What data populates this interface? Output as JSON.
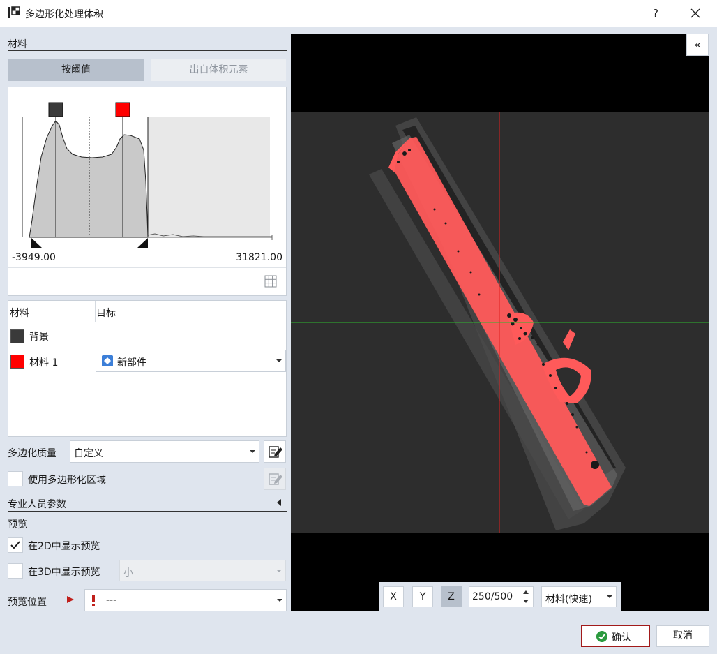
{
  "window": {
    "title": "多边形化处理体积",
    "help_label": "?"
  },
  "materials_section": {
    "title": "材料"
  },
  "mode_tabs": {
    "threshold": "按阈值",
    "from_volume": "出自体积元素"
  },
  "histogram": {
    "min_label": "-3949.00",
    "max_label": "31821.00"
  },
  "material_table": {
    "col_material": "材料",
    "col_target": "目标",
    "rows": [
      {
        "name": "背景",
        "color": "#3a3a3a",
        "target": ""
      },
      {
        "name": "材料 1",
        "color": "#ff0000",
        "target": "新部件"
      }
    ]
  },
  "polygonize": {
    "quality_label": "多边化质量",
    "quality_value": "自定义",
    "region_label": "使用多边形化区域",
    "region_checked": false
  },
  "expert": {
    "title": "专业人员参数"
  },
  "preview": {
    "title": "预览",
    "show2d_label": "在2D中显示预览",
    "show2d_checked": true,
    "show3d_label": "在3D中显示预览",
    "show3d_checked": false,
    "show3d_size": "小",
    "position_label": "预览位置",
    "position_value": "---"
  },
  "viewer": {
    "collapse_label": "«",
    "axis_x": "X",
    "axis_y": "Y",
    "axis_z": "Z",
    "active_axis": "Z",
    "slice": "250/500",
    "mode": "材料(快速)"
  },
  "footer": {
    "ok_label": "确认",
    "cancel_label": "取消"
  },
  "colors": {
    "accent_ok": "#2b9a3e",
    "highlight_material": "#ff0000",
    "slice_h": "#2fb82f",
    "slice_v": "#e02020"
  }
}
